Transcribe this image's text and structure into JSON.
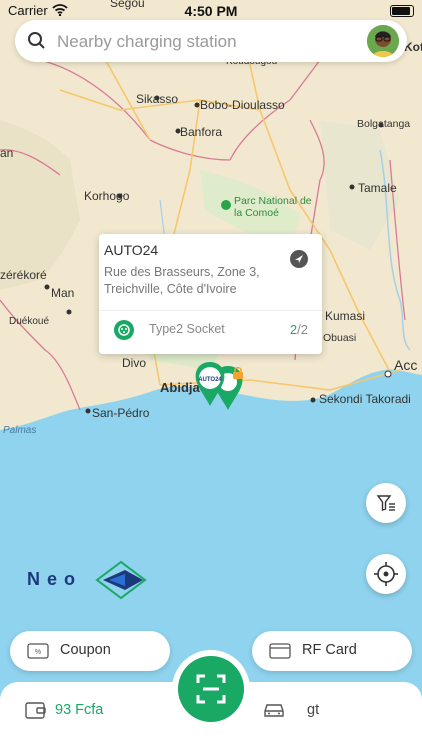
{
  "status": {
    "carrier": "Carrier",
    "time": "4:50 PM"
  },
  "search": {
    "placeholder": "Nearby charging station"
  },
  "map": {
    "places": [
      "Segou",
      "Kot",
      "Koudougou",
      "Sikasso",
      "Bobo-Dioulasso",
      "Banfora",
      "Bolgatanga",
      "an",
      "Korhogo",
      "Parc National de la Comoé",
      "Tamale",
      "zérékoré",
      "Man",
      "Duékoué",
      "Kumasi",
      "Obuasi",
      "Divo",
      "Abidja",
      "Acc",
      "San-Pédro",
      "Sekondi Takoradi",
      "Palmas"
    ]
  },
  "station_card": {
    "title": "AUTO24",
    "address": "Rue des Brasseurs, Zone 3, Treichville, Côte d'Ivoire",
    "socket_label": "Type2 Socket",
    "available": "2",
    "total": "/2"
  },
  "logo": {
    "text": "Neo"
  },
  "buttons": {
    "coupon": "Coupon",
    "rf_card": "RF Card"
  },
  "bottom_bar": {
    "wallet": "93 Fcfa",
    "vehicle": "gt"
  },
  "colors": {
    "accent": "#1aa865",
    "map_land": "#f3ead4",
    "map_water": "#8fd3ee",
    "border": "#d96b8a"
  },
  "icons": [
    "search-icon",
    "wifi-icon",
    "battery-icon",
    "navigate-icon",
    "socket-icon",
    "filter-icon",
    "locate-icon",
    "coupon-icon",
    "card-icon",
    "wallet-icon",
    "car-icon",
    "scan-icon",
    "map-pin-icon",
    "lock-icon"
  ]
}
